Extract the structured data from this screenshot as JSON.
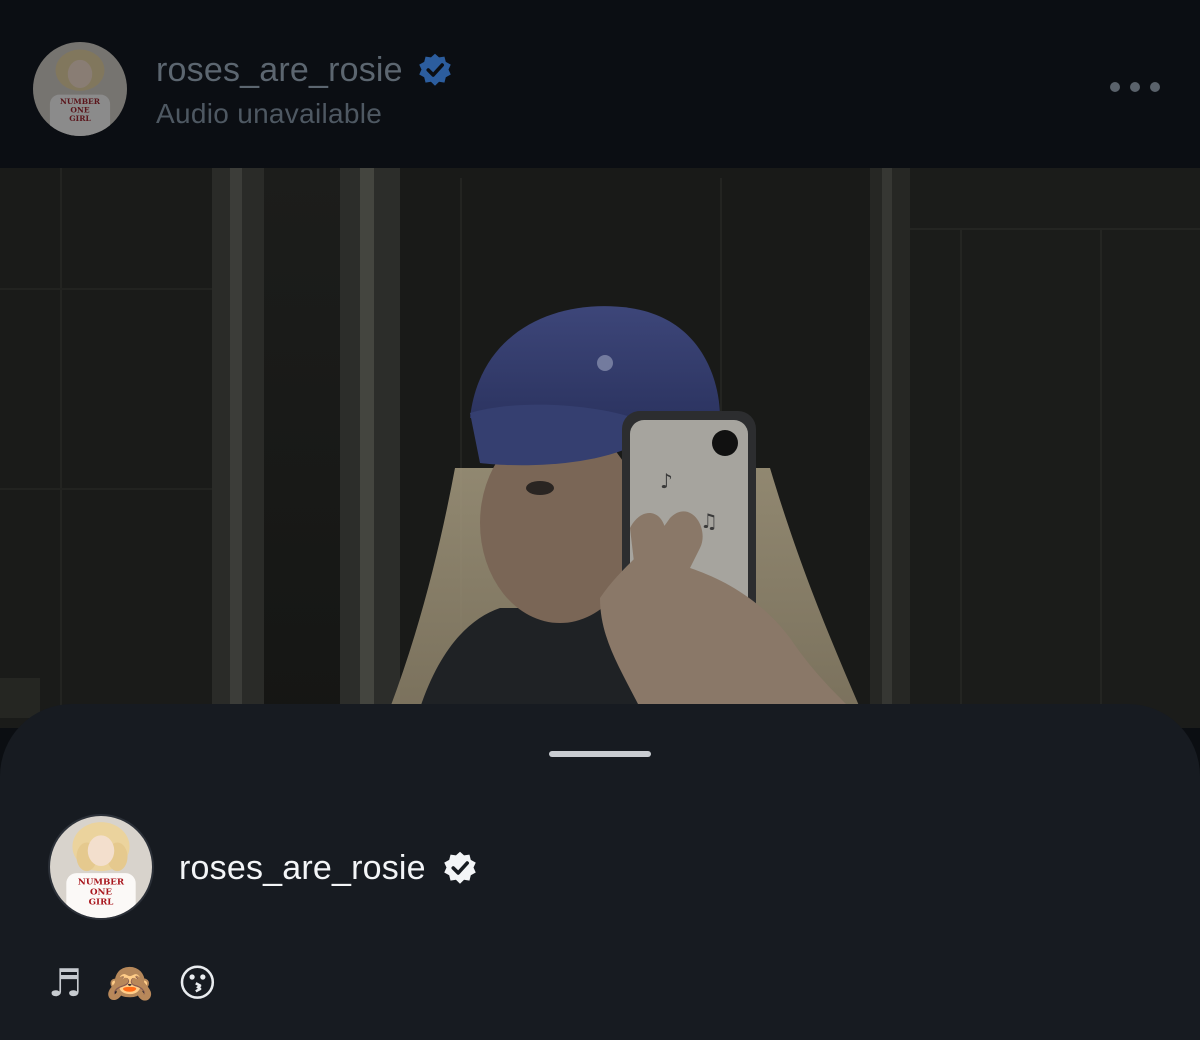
{
  "header": {
    "username": "roses_are_rosie",
    "subtitle": "Audio unavailable",
    "verified_icon": "verified-badge-icon",
    "more_icon": "more-horizontal-icon",
    "avatar_shirt_text": [
      "NUMBER",
      "ONE",
      "GIRL"
    ]
  },
  "post": {
    "image_icon": "selfie-photo"
  },
  "sheet": {
    "username": "roses_are_rosie",
    "verified_icon": "verified-badge-icon",
    "avatar_shirt_text": [
      "NUMBER",
      "ONE",
      "GIRL"
    ],
    "caption": {
      "note": "♬",
      "monkey": "🙈",
      "kiss": "😗"
    }
  },
  "colors": {
    "background": "#0b0e12",
    "sheet": "#171b21",
    "verified_dim": "#2c5d9e",
    "verified_light": "#f3f5f7"
  }
}
